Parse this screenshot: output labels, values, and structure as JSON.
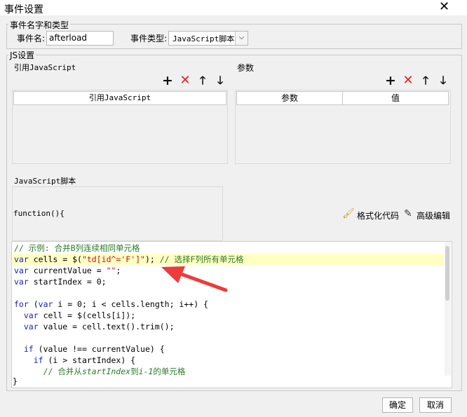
{
  "window": {
    "title": "事件设置"
  },
  "name_group": {
    "label": "事件名字和类型",
    "event_name_label": "事件名:",
    "event_name_value": "afterload",
    "event_type_label": "事件类型:",
    "event_type_value": "JavaScript脚本"
  },
  "js_group": {
    "label": "JS设置",
    "ref_js": {
      "label": "引用JavaScript",
      "column": "引用JavaScript"
    },
    "params": {
      "label": "参数",
      "col_param": "参数",
      "col_value": "值"
    },
    "script_label": "JavaScript脚本",
    "function_header": "function(){",
    "format_code": "格式化代码",
    "advanced_edit": "高级编辑"
  },
  "code": {
    "l1": "// 示例: 合并B列连续相同单元格",
    "l2_kw": "var",
    "l2_a": " cells = $(",
    "l2_str": "\"td[id^='F']\"",
    "l2_b": "); ",
    "l2_cm": "// 选择F列所有单元格",
    "l3_kw": "var",
    "l3_a": " currentValue = ",
    "l3_str": "\"\"",
    "l3_b": ";",
    "l4_kw": "var",
    "l4_a": " startIndex = 0;",
    "l6_kw": "for",
    "l6_a": " (",
    "l6_kw2": "var",
    "l6_b": " i = 0; i < cells.length; i++) {",
    "l7_kw": "var",
    "l7_a": " cell = $(cells[i]);",
    "l8_kw": "var",
    "l8_a": " value = cell.text().trim();",
    "l10_kw": "if",
    "l10_a": " (value !== currentValue) {",
    "l11_kw": "if",
    "l11_a": " (i > startIndex) {",
    "l12_cm1": "// 合并从",
    "l12_cmi1": "startIndex",
    "l12_cm2": "到",
    "l12_cmi2": "i-1",
    "l12_cm3": "的单元格",
    "closing": "}"
  },
  "footer": {
    "ok": "确定",
    "cancel": "取消"
  },
  "colors": {
    "highlight_line": "#ffffc4",
    "annotation_arrow": "#ee3b3b"
  }
}
